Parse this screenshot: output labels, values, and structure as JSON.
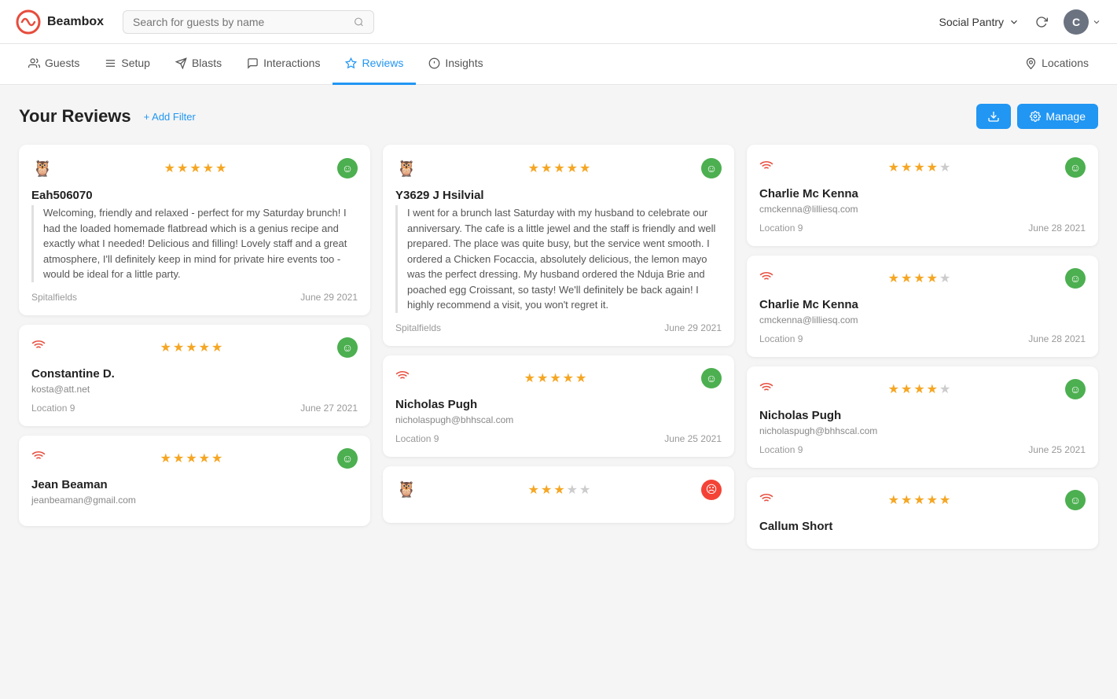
{
  "header": {
    "logo_text": "Beambox",
    "search_placeholder": "Search for guests by name",
    "venue": "Social Pantry",
    "avatar_initials": "C"
  },
  "nav": {
    "items": [
      {
        "id": "guests",
        "label": "Guests",
        "active": false
      },
      {
        "id": "setup",
        "label": "Setup",
        "active": false
      },
      {
        "id": "blasts",
        "label": "Blasts",
        "active": false
      },
      {
        "id": "interactions",
        "label": "Interactions",
        "active": false
      },
      {
        "id": "reviews",
        "label": "Reviews",
        "active": true
      },
      {
        "id": "insights",
        "label": "Insights",
        "active": false
      },
      {
        "id": "locations",
        "label": "Locations",
        "active": false
      }
    ]
  },
  "page": {
    "title": "Your Reviews",
    "add_filter_label": "+ Add Filter",
    "download_label": "⬇",
    "manage_label": "Manage"
  },
  "columns": [
    {
      "reviews": [
        {
          "id": "r1",
          "source": "tripadvisor",
          "stars": 5,
          "sentiment": "positive",
          "guest_name": "Eah506070",
          "guest_email": "",
          "review_text": "Welcoming, friendly and relaxed - perfect for my Saturday brunch! I had the loaded homemade flatbread which is a genius recipe and exactly what I needed! Delicious and filling! Lovely staff and a great atmosphere, I'll definitely keep in mind for private hire events too - would be ideal for a little party.",
          "location": "Spitalfields",
          "date": "June 29 2021"
        },
        {
          "id": "r2",
          "source": "wifi",
          "stars": 5,
          "sentiment": "positive",
          "guest_name": "Constantine D.",
          "guest_email": "kosta@att.net",
          "review_text": "",
          "location": "Location 9",
          "date": "June 27 2021"
        },
        {
          "id": "r3",
          "source": "wifi",
          "stars": 5,
          "sentiment": "positive",
          "guest_name": "Jean Beaman",
          "guest_email": "jeanbeaman@gmail.com",
          "review_text": "",
          "location": "",
          "date": ""
        }
      ]
    },
    {
      "reviews": [
        {
          "id": "r4",
          "source": "tripadvisor",
          "stars": 5,
          "sentiment": "positive",
          "guest_name": "Y3629 J Hsilvial",
          "guest_email": "",
          "review_text": "I went for a brunch last Saturday with my husband to celebrate our anniversary. The cafe is a little jewel and the staff is friendly and well prepared. The place was quite busy, but the service went smooth. I ordered a Chicken Focaccia, absolutely delicious, the lemon mayo was the perfect dressing. My husband ordered the Nduja Brie and poached egg Croissant, so tasty! We'll definitely be back again! I highly recommend a visit, you won't regret it.",
          "location": "Spitalfields",
          "date": "June 29 2021"
        },
        {
          "id": "r5",
          "source": "wifi",
          "stars": 5,
          "sentiment": "positive",
          "guest_name": "Nicholas Pugh",
          "guest_email": "nicholaspugh@bhhscal.com",
          "review_text": "",
          "location": "Location 9",
          "date": "June 25 2021"
        },
        {
          "id": "r6",
          "source": "tripadvisor",
          "stars": 3,
          "sentiment": "negative",
          "guest_name": "",
          "guest_email": "",
          "review_text": "",
          "location": "",
          "date": ""
        }
      ]
    },
    {
      "reviews": [
        {
          "id": "r7",
          "source": "wifi",
          "stars": 4.5,
          "sentiment": "positive",
          "guest_name": "Charlie Mc Kenna",
          "guest_email": "cmckenna@lilliesq.com",
          "review_text": "",
          "location": "Location 9",
          "date": "June 28 2021"
        },
        {
          "id": "r8",
          "source": "wifi",
          "stars": 4.5,
          "sentiment": "positive",
          "guest_name": "Charlie Mc Kenna",
          "guest_email": "cmckenna@lilliesq.com",
          "review_text": "",
          "location": "Location 9",
          "date": "June 28 2021"
        },
        {
          "id": "r9",
          "source": "wifi",
          "stars": 4.5,
          "sentiment": "positive",
          "guest_name": "Nicholas Pugh",
          "guest_email": "nicholaspugh@bhhscal.com",
          "review_text": "",
          "location": "Location 9",
          "date": "June 25 2021"
        },
        {
          "id": "r10",
          "source": "wifi",
          "stars": 5,
          "sentiment": "positive",
          "guest_name": "Callum Short",
          "guest_email": "",
          "review_text": "",
          "location": "",
          "date": ""
        }
      ]
    }
  ]
}
